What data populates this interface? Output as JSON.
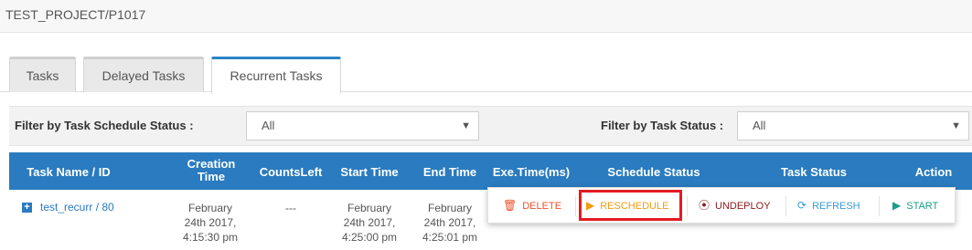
{
  "breadcrumb": "TEST_PROJECT/P1017",
  "tabs": [
    {
      "label": "Tasks"
    },
    {
      "label": "Delayed Tasks"
    },
    {
      "label": "Recurrent Tasks"
    }
  ],
  "filters": {
    "schedule_label": "Filter by Task Schedule Status :",
    "schedule_value": "All",
    "status_label": "Filter by Task Status :",
    "status_value": "All"
  },
  "columns": {
    "task": "Task Name / ID",
    "creation_1": "Creation",
    "creation_2": "Time",
    "counts": "CountsLeft",
    "start": "Start Time",
    "end": "End Time",
    "exe": "Exe.Time(ms)",
    "schedule": "Schedule Status",
    "status": "Task Status",
    "action": "Action"
  },
  "row": {
    "name": "test_recurr",
    "sep": " / ",
    "id": "80",
    "creation": [
      "February",
      "24th 2017,",
      "4:15:30 pm"
    ],
    "counts": "---",
    "start": [
      "February",
      "24th 2017,",
      "4:25:00 pm"
    ],
    "end": [
      "February",
      "24th 2017,",
      "4:25:01 pm"
    ]
  },
  "actions": {
    "delete": "DELETE",
    "reschedule": "RESCHEDULE",
    "undeploy": "UNDEPLOY",
    "refresh": "REFRESH",
    "start": "START"
  },
  "colors": {
    "header_blue": "#2a7bbf",
    "delete": "#e8552c",
    "reschedule": "#f39c12",
    "undeploy": "#8b1a1a",
    "refresh": "#3a9bd9",
    "start": "#1a9e8a",
    "highlight": "#e31b23"
  }
}
